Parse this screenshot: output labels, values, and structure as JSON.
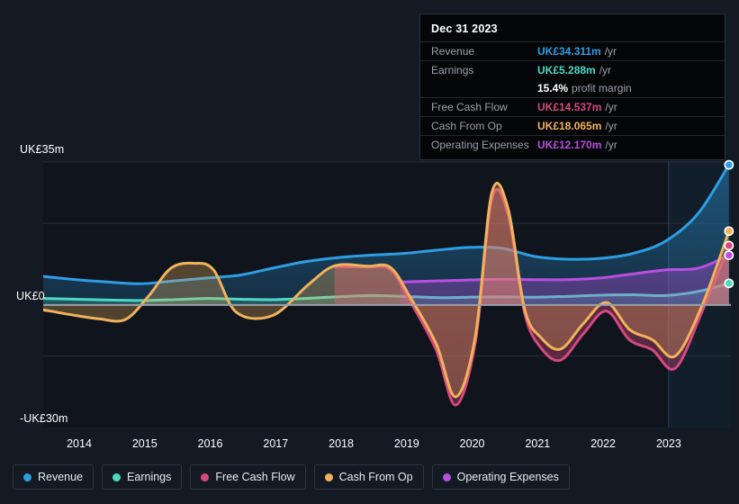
{
  "tooltip": {
    "title": "Dec 31 2023",
    "rows": [
      {
        "name": "Revenue",
        "value": "UK£34.311m",
        "unit": "/yr",
        "color": "#2e9ee4"
      },
      {
        "name": "Earnings",
        "value": "UK£5.288m",
        "unit": "/yr",
        "color": "#4fd8c0"
      },
      {
        "name": "Free Cash Flow",
        "value": "UK£14.537m",
        "unit": "/yr",
        "color": "#d6497e"
      },
      {
        "name": "Cash From Op",
        "value": "UK£18.065m",
        "unit": "/yr",
        "color": "#f0b35b"
      },
      {
        "name": "Operating Expenses",
        "value": "UK£12.170m",
        "unit": "/yr",
        "color": "#b94fe0"
      }
    ],
    "margin_value": "15.4%",
    "margin_text": "profit margin"
  },
  "legend": {
    "items": [
      {
        "label": "Revenue",
        "color": "#2e9ee4"
      },
      {
        "label": "Earnings",
        "color": "#4fd8c0"
      },
      {
        "label": "Free Cash Flow",
        "color": "#d6497e"
      },
      {
        "label": "Cash From Op",
        "color": "#f0b35b"
      },
      {
        "label": "Operating Expenses",
        "color": "#b94fe0"
      }
    ]
  },
  "axis": {
    "y_top": "UK£35m",
    "y_zero": "UK£0",
    "y_bottom": "-UK£30m",
    "x_ticks": [
      "2014",
      "2015",
      "2016",
      "2017",
      "2018",
      "2019",
      "2020",
      "2021",
      "2022",
      "2023"
    ]
  },
  "chart_data": {
    "type": "area",
    "title": "",
    "xlabel": "",
    "ylabel": "UK£ (millions)",
    "ylim": [
      -30,
      35
    ],
    "xlim": [
      2013.45,
      2023.95
    ],
    "grid": true,
    "legend_position": "bottom",
    "y_ticks": [
      35,
      0,
      -30
    ],
    "y_tick_labels": [
      "UK£35m",
      "UK£0",
      "-UK£30m"
    ],
    "x_ticks": [
      2014,
      2015,
      2016,
      2017,
      2018,
      2019,
      2020,
      2021,
      2022,
      2023
    ],
    "currency": "UK£",
    "units": "millions per year",
    "forecast_divider_x": 2023.0,
    "series": [
      {
        "name": "Revenue",
        "color": "#2e9ee4",
        "x": [
          2013.45,
          2013.95,
          2014.45,
          2014.95,
          2015.45,
          2015.95,
          2016.45,
          2016.95,
          2017.45,
          2017.95,
          2018.45,
          2018.95,
          2019.45,
          2019.95,
          2020.45,
          2020.95,
          2021.45,
          2021.95,
          2022.45,
          2022.95,
          2023.45,
          2023.92
        ],
        "values": [
          7.0,
          6.2,
          5.6,
          5.2,
          5.9,
          6.6,
          7.3,
          9.0,
          10.6,
          11.6,
          12.2,
          12.6,
          13.4,
          14.1,
          13.9,
          11.9,
          11.2,
          11.4,
          12.6,
          15.6,
          22.4,
          34.311
        ]
      },
      {
        "name": "Earnings",
        "color": "#4fd8c0",
        "x": [
          2013.45,
          2013.95,
          2014.45,
          2014.95,
          2015.45,
          2015.95,
          2016.45,
          2016.95,
          2017.45,
          2017.95,
          2018.45,
          2018.95,
          2019.45,
          2019.95,
          2020.45,
          2020.95,
          2021.45,
          2021.95,
          2022.45,
          2022.95,
          2023.45,
          2023.92
        ],
        "values": [
          1.6,
          1.4,
          1.2,
          1.1,
          1.3,
          1.6,
          1.4,
          1.3,
          1.6,
          2.0,
          2.3,
          2.1,
          1.8,
          1.9,
          2.0,
          1.9,
          2.1,
          2.4,
          2.5,
          2.3,
          3.3,
          5.288
        ]
      },
      {
        "name": "Free Cash Flow",
        "color": "#d6497e",
        "x": [
          2017.9,
          2018.4,
          2018.75,
          2019.05,
          2019.45,
          2019.75,
          2020.05,
          2020.3,
          2020.55,
          2020.8,
          2021.05,
          2021.35,
          2021.7,
          2022.05,
          2022.4,
          2022.75,
          2023.1,
          2023.5,
          2023.92
        ],
        "values": [
          9.4,
          9.3,
          8.7,
          1.0,
          -11.0,
          -24.5,
          -9.0,
          26.0,
          22.0,
          -2.0,
          -10.5,
          -13.5,
          -7.0,
          -1.5,
          -8.5,
          -11.0,
          -15.5,
          -2.0,
          14.537
        ]
      },
      {
        "name": "Cash From Op",
        "color": "#f0b35b",
        "x": [
          2013.45,
          2013.95,
          2014.3,
          2014.7,
          2015.05,
          2015.4,
          2015.75,
          2016.05,
          2016.4,
          2016.95,
          2017.5,
          2017.9,
          2018.4,
          2018.75,
          2019.05,
          2019.45,
          2019.75,
          2020.05,
          2020.3,
          2020.55,
          2020.8,
          2021.05,
          2021.35,
          2021.7,
          2022.05,
          2022.4,
          2022.75,
          2023.1,
          2023.5,
          2023.92
        ],
        "values": [
          -1.2,
          -2.6,
          -3.4,
          -3.6,
          2.0,
          9.0,
          10.2,
          8.6,
          -1.8,
          -2.6,
          5.0,
          9.6,
          9.5,
          9.2,
          2.0,
          -9.5,
          -22.5,
          -7.5,
          27.5,
          23.5,
          -1.0,
          -8.0,
          -10.8,
          -4.5,
          0.6,
          -6.0,
          -8.5,
          -12.5,
          -0.5,
          18.065
        ]
      },
      {
        "name": "Operating Expenses",
        "color": "#b94fe0",
        "x": [
          2018.9,
          2019.45,
          2019.95,
          2020.45,
          2020.95,
          2021.45,
          2021.95,
          2022.45,
          2022.95,
          2023.45,
          2023.92
        ],
        "values": [
          5.6,
          5.9,
          6.1,
          6.3,
          6.2,
          6.2,
          6.6,
          7.6,
          8.6,
          9.0,
          12.17
        ]
      }
    ]
  }
}
